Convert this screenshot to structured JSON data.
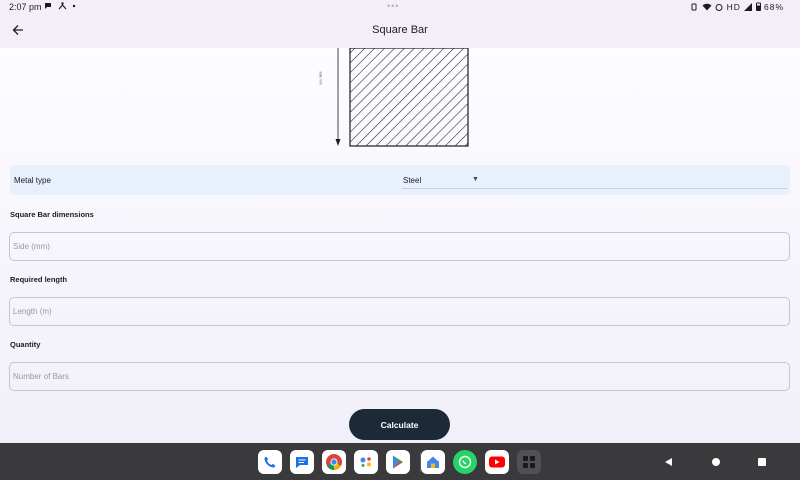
{
  "status_bar": {
    "time": "2:07 pm",
    "left_icons": [
      "chat-bubble-icon",
      "accessibility-icon",
      "dot-icon"
    ],
    "center_dots": "•••",
    "right_text": "HD",
    "battery": "68%"
  },
  "app_bar": {
    "title": "Square Bar",
    "back_icon": "arrow-back-icon"
  },
  "diagram": {
    "side_label": "side mm"
  },
  "metal_type": {
    "label": "Metal type",
    "selected": "Steel",
    "caret": "▼"
  },
  "dimensions": {
    "label": "Square Bar dimensions",
    "placeholder": "Side (mm)"
  },
  "length": {
    "label": "Required length",
    "placeholder": "Length (m)"
  },
  "quantity": {
    "label": "Quantity",
    "placeholder": "Number of Bars"
  },
  "calculate_label": "Calculate",
  "dock": {
    "apps": [
      "phone-icon",
      "messages-icon",
      "chrome-icon",
      "assistant-icon",
      "play-store-icon",
      "home-icon",
      "whatsapp-icon",
      "youtube-icon",
      "app-drawer-icon"
    ]
  },
  "colors": {
    "accent": "#1c2a38",
    "metal_row_bg": "#e7f0fc",
    "nav_bg": "#3a3a3d"
  }
}
